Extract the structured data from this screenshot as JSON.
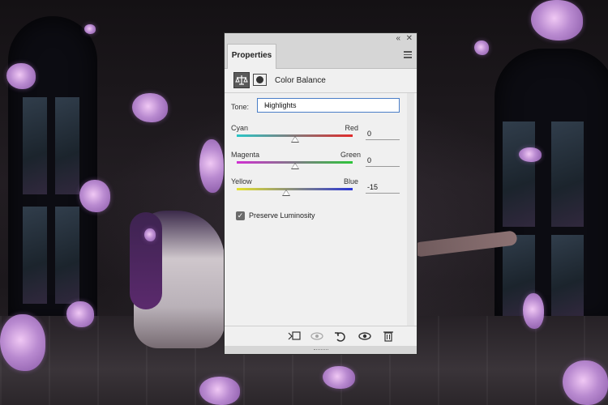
{
  "panel": {
    "tab_label": "Properties",
    "collapse_glyph": "«",
    "close_glyph": "✕",
    "adjustment_title": "Color Balance",
    "tone": {
      "label": "Tone:",
      "selected": "Highlights",
      "chevron": "⌄"
    },
    "sliders": [
      {
        "left_label": "Cyan",
        "right_label": "Red",
        "value": "0",
        "position": 0.5,
        "colors": [
          "#29c6c7",
          "#e12a2a"
        ]
      },
      {
        "left_label": "Magenta",
        "right_label": "Green",
        "value": "0",
        "position": 0.5,
        "colors": [
          "#d12fd2",
          "#2dc53a"
        ]
      },
      {
        "left_label": "Yellow",
        "right_label": "Blue",
        "value": "-15",
        "position": 0.425,
        "colors": [
          "#e4e22d",
          "#2a35d6"
        ]
      }
    ],
    "preserve_luminosity": {
      "label": "Preserve Luminosity",
      "checked": true
    },
    "footer_icons": [
      "clip-to-layer-icon",
      "view-previous-state-icon",
      "reset-icon",
      "visibility-eye-icon",
      "trash-icon"
    ]
  }
}
